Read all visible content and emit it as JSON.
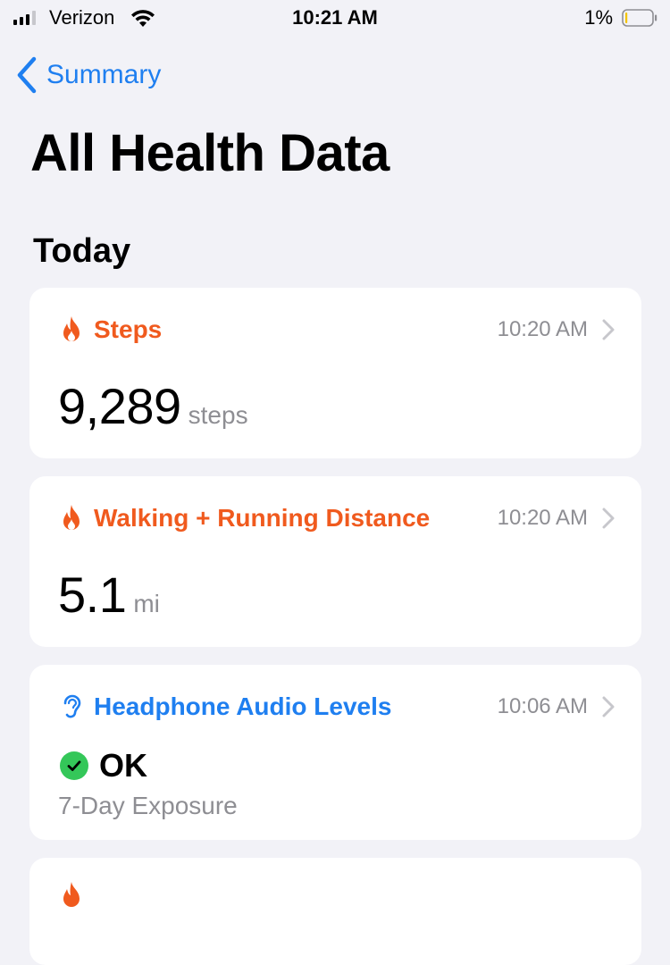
{
  "status_bar": {
    "carrier": "Verizon",
    "time": "10:21 AM",
    "battery_percent": "1%"
  },
  "nav": {
    "back_label": "Summary"
  },
  "page": {
    "title": "All Health Data",
    "section_title": "Today"
  },
  "cards": [
    {
      "title": "Steps",
      "time": "10:20 AM",
      "value": "9,289",
      "unit": "steps",
      "icon": "flame-icon",
      "color": "#f05a1e"
    },
    {
      "title": "Walking + Running Distance",
      "time": "10:20 AM",
      "value": "5.1",
      "unit": "mi",
      "icon": "flame-icon",
      "color": "#f05a1e"
    },
    {
      "title": "Headphone Audio Levels",
      "time": "10:06 AM",
      "status": "OK",
      "subtitle": "7-Day Exposure",
      "icon": "ear-icon",
      "color": "#1f7ff0"
    }
  ],
  "colors": {
    "background": "#f2f2f7",
    "accent_blue": "#1f7ff0",
    "accent_orange": "#f05a1e",
    "ok_green": "#34c759",
    "secondary_text": "#8e8e93"
  }
}
